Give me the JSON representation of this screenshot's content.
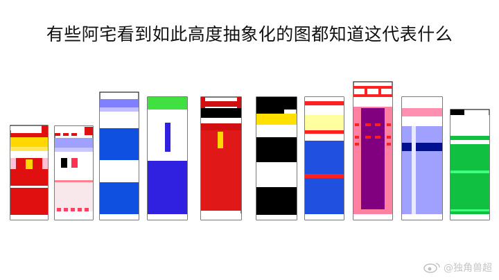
{
  "title": "有些阿宅看到如此高度抽象化的图都知道这代表什么",
  "watermark": {
    "text": "@独角兽超",
    "icon": "weibo-icon"
  },
  "figures": [
    {
      "name": "figure-1",
      "colors": [
        "#ffd800",
        "#e01010",
        "#ffffff",
        "#ffc0d8"
      ]
    },
    {
      "name": "figure-2",
      "colors": [
        "#a0a0ff",
        "#ff4060",
        "#ffffff",
        "#ff8090"
      ]
    },
    {
      "name": "figure-3",
      "colors": [
        "#8080ff",
        "#ffffff",
        "#1050e0"
      ]
    },
    {
      "name": "figure-4",
      "colors": [
        "#40e040",
        "#ffffff",
        "#3020e0"
      ]
    },
    {
      "name": "figure-5",
      "colors": [
        "#d01010",
        "#ffffff",
        "#ffd800"
      ]
    },
    {
      "name": "figure-6",
      "colors": [
        "#000000",
        "#ffe000",
        "#ffffff"
      ]
    },
    {
      "name": "figure-7",
      "colors": [
        "#ff2020",
        "#ffffa0",
        "#2050e0"
      ]
    },
    {
      "name": "figure-8",
      "colors": [
        "#800080",
        "#ff2020",
        "#ff80a0"
      ]
    },
    {
      "name": "figure-9",
      "colors": [
        "#ff90b0",
        "#a0a0ff",
        "#001090"
      ]
    },
    {
      "name": "figure-10",
      "colors": [
        "#000000",
        "#10c040",
        "#40ff80"
      ]
    }
  ]
}
